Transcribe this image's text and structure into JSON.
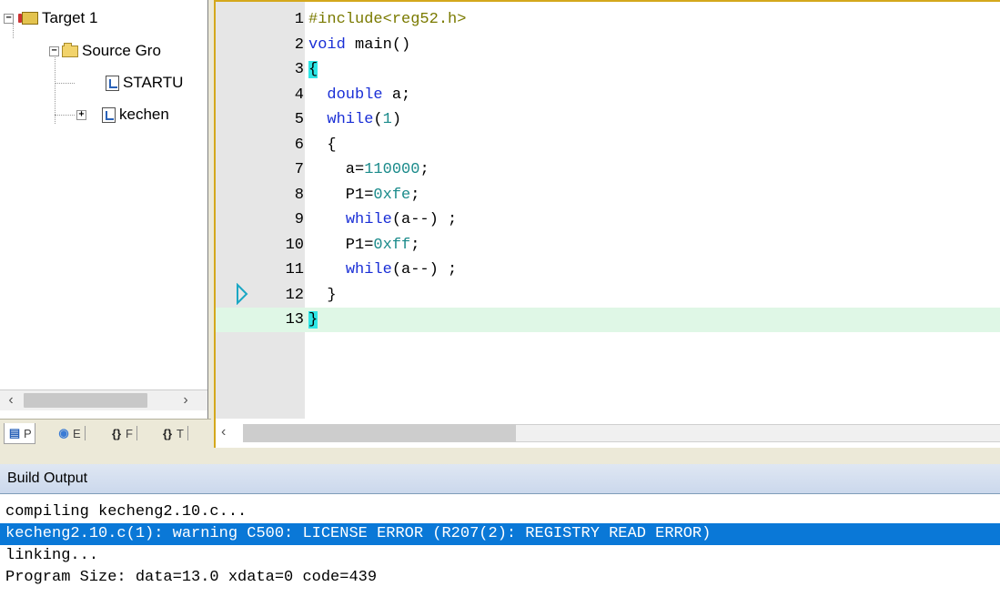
{
  "project_tree": {
    "items": [
      {
        "label": "Target 1",
        "icon": "target-folder-icon",
        "expander": "−"
      },
      {
        "label": "Source Gro",
        "icon": "folder-icon",
        "expander": "−"
      },
      {
        "label": "STARTU",
        "icon": "c-file-icon",
        "expander": ""
      },
      {
        "label": "kechen",
        "icon": "c-file-icon",
        "expander": "+"
      }
    ],
    "tabs": [
      {
        "label": "P",
        "icon": "project-icon"
      },
      {
        "label": "E",
        "icon": "books-icon"
      },
      {
        "label": "F",
        "icon": "functions-icon"
      },
      {
        "label": "T",
        "icon": "templates-icon"
      }
    ]
  },
  "editor": {
    "lines": [
      {
        "num": "1",
        "text": "#include<reg52.h>"
      },
      {
        "num": "2",
        "text": "void main()"
      },
      {
        "num": "3",
        "text": "{"
      },
      {
        "num": "4",
        "text": "  double a;"
      },
      {
        "num": "5",
        "text": "  while(1)"
      },
      {
        "num": "6",
        "text": "  {"
      },
      {
        "num": "7",
        "text": "    a=110000;"
      },
      {
        "num": "8",
        "text": "    P1=0xfe;"
      },
      {
        "num": "9",
        "text": "    while(a--) ;"
      },
      {
        "num": "10",
        "text": "    P1=0xff;"
      },
      {
        "num": "11",
        "text": "    while(a--) ;"
      },
      {
        "num": "12",
        "text": "  }"
      },
      {
        "num": "13",
        "text": "}"
      }
    ],
    "current_line": 13,
    "marker_line": 12
  },
  "build_output": {
    "title": "Build Output",
    "lines": [
      "compiling kecheng2.10.c...",
      "kecheng2.10.c(1): warning C500: LICENSE ERROR (R207(2): REGISTRY READ ERROR)",
      "linking...",
      "Program Size: data=13.0 xdata=0 code=439"
    ],
    "selected_index": 1
  }
}
